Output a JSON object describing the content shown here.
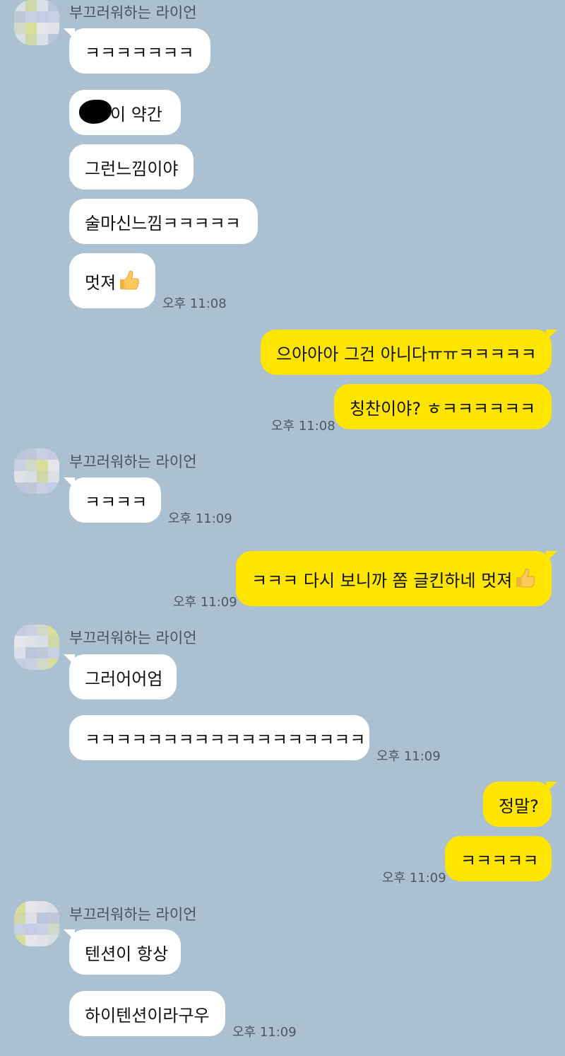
{
  "sender_name": "부끄러워하는 라이언",
  "colors": {
    "background": "#abc1d1",
    "incoming_bubble": "#ffffff",
    "outgoing_bubble": "#fee500"
  },
  "messages": [
    {
      "text": "ㅋㅋㅋㅋㅋㅋㅋ"
    },
    {
      "text": "이 약간",
      "note": "redacted"
    },
    {
      "text": "그런느낌이야"
    },
    {
      "text": "술마신느낌ㅋㅋㅋㅋㅋ"
    },
    {
      "text": "멋져",
      "icon": "thumbs-up-icon",
      "time": "오후 11:08"
    },
    {
      "text": "으아아아 그건 아니다ㅠㅠㅋㅋㅋㅋㅋ"
    },
    {
      "text": "칭찬이야? ㅎㅋㅋㅋㅋㅋㅋ",
      "time": "오후 11:08"
    },
    {
      "text": "ㅋㅋㅋㅋ",
      "time": "오후 11:09"
    },
    {
      "text": "ㅋㅋㅋ 다시 보니까 쫌 글킨하네 멋져",
      "icon": "thumbs-up-icon",
      "time": "오후 11:09"
    },
    {
      "text": "그러어어엄"
    },
    {
      "text": "ㅋㅋㅋㅋㅋㅋㅋㅋㅋㅋㅋㅋㅋㅋㅋㅋㅋㅋ",
      "time": "오후 11:09"
    },
    {
      "text": "정말?"
    },
    {
      "text": "ㅋㅋㅋㅋㅋ",
      "time": "오후 11:09"
    },
    {
      "text": "텐션이 항상"
    },
    {
      "text": "하이텐션이라구우",
      "time": "오후 11:09"
    }
  ]
}
